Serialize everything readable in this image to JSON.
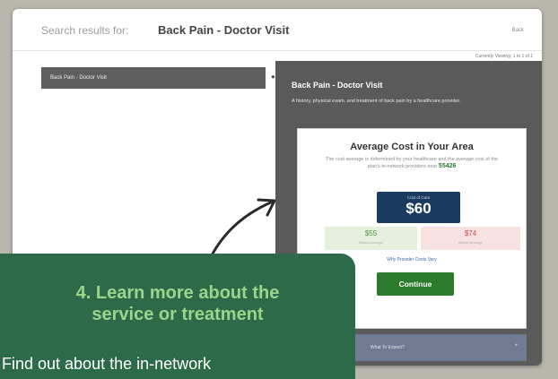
{
  "header": {
    "search_prefix": "Search results for:",
    "search_query": "Back Pain - Doctor Visit",
    "back_label": "Back"
  },
  "results": {
    "viewing_label": "Currently Viewing: 1 to 1 of 1",
    "items": [
      {
        "label": "Back Pain - Doctor Visit"
      }
    ]
  },
  "detail": {
    "title": "Back Pain - Doctor Visit",
    "description": "A history, physical exam, and treatment of back pain by a healthcare provider.",
    "cost_title": "Average Cost in Your Area",
    "cost_description": "The cost average is determined by your healthcare and the average cost of the plan's in-network providers near",
    "zip": "55426",
    "price_label": "Cost of Care",
    "price_value": "$60",
    "low_value": "$55",
    "low_label": "Below Average",
    "high_value": "$74",
    "high_label": "Above Average",
    "why_label": "Why Provider Costs Vary",
    "continue_label": "Continue",
    "accordion_label": "What To Expect?",
    "accordion_icon": "+"
  },
  "overlay": {
    "heading_line1": "4. Learn more about the",
    "heading_line2": "service or treatment",
    "body": "Find out about the in-network"
  },
  "colors": {
    "accent_green": "#2c7a2c",
    "price_navy": "#1a3a60",
    "overlay_green": "#2d6a4a",
    "overlay_heading": "#9bd58a"
  }
}
